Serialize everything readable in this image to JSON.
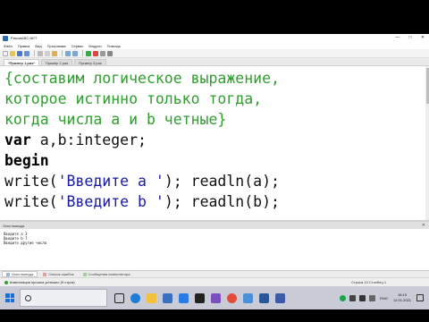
{
  "window": {
    "title": "PascalABC.NET",
    "controls": [
      "—",
      "□",
      "✕"
    ]
  },
  "menu": [
    "Файл",
    "Правка",
    "Вид",
    "Программа",
    "Сервис",
    "Модули",
    "Помощь"
  ],
  "tabs": [
    {
      "label": "*Пример 1.pas*",
      "active": true
    },
    {
      "label": "Пример 2.pas",
      "active": false
    },
    {
      "label": "Пример 3.pas",
      "active": false
    }
  ],
  "editor": {
    "lines": [
      {
        "parts": [
          {
            "t": "{составим логическое выражение,",
            "k": "cmt"
          }
        ]
      },
      {
        "parts": [
          {
            "t": "которое истинно только тогда,",
            "k": "cmt"
          }
        ]
      },
      {
        "parts": [
          {
            "t": "когда числа a и b четные}",
            "k": "cmt"
          }
        ]
      },
      {
        "parts": [
          {
            "t": "var",
            "k": "kw"
          },
          {
            "t": " a,b:integer;",
            "k": ""
          }
        ]
      },
      {
        "parts": [
          {
            "t": "begin",
            "k": "kw"
          }
        ]
      },
      {
        "parts": [
          {
            "t": "write(",
            "k": ""
          },
          {
            "t": "'Введите a '",
            "k": "str"
          },
          {
            "t": "); readln(a);",
            "k": ""
          }
        ]
      },
      {
        "parts": [
          {
            "t": "write(",
            "k": ""
          },
          {
            "t": "'Введите b '",
            "k": "str"
          },
          {
            "t": "); readln(b);",
            "k": ""
          }
        ]
      }
    ]
  },
  "output": {
    "title": "Окно вывода",
    "close": "✕",
    "lines": [
      "Введите a 3",
      "Введите b 7",
      "Введите другие числа"
    ]
  },
  "bottom_tabs": [
    "Окно вывода",
    "Список ошибок",
    "Сообщения компилятора"
  ],
  "status": {
    "message": "Компиляция прошла успешно (9 строк)",
    "position": "Строка 10   Столбец 1"
  },
  "taskbar": {
    "lang": "ENG",
    "time": "16:19",
    "date": "12.01.2021"
  },
  "colors": {
    "comment": "#2f9e2f",
    "string": "#1a1aa6",
    "keyword": "#000000"
  }
}
